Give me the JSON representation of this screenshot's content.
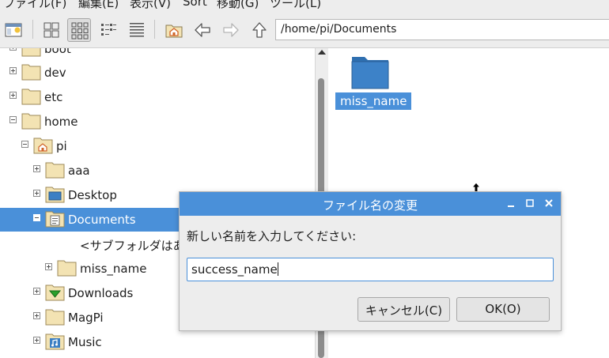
{
  "menu": [
    "ファイル(F)",
    "編集(E)",
    "表示(V)",
    "Sort",
    "移動(G)",
    "ツール(L)"
  ],
  "toolbar": {
    "path": "/home/pi/Documents",
    "buttons": [
      "new-window-icon",
      "icon-view-icon",
      "thumbnail-view-icon",
      "compact-view-icon",
      "detailed-list-view-icon",
      "home-icon",
      "back-icon",
      "forward-icon",
      "up-icon"
    ]
  },
  "tree": {
    "items": [
      {
        "label": "boot",
        "expander": "plus",
        "icon": "folder"
      },
      {
        "label": "dev",
        "expander": "plus",
        "icon": "folder"
      },
      {
        "label": "etc",
        "expander": "plus",
        "icon": "folder"
      },
      {
        "label": "home",
        "expander": "minus",
        "icon": "folder"
      },
      {
        "label": "pi",
        "expander": "minus",
        "icon": "home-folder"
      },
      {
        "label": "aaa",
        "expander": "plus",
        "icon": "folder"
      },
      {
        "label": "Desktop",
        "expander": "plus",
        "icon": "desktop-folder"
      },
      {
        "label": "Documents",
        "expander": "minus",
        "icon": "documents-folder",
        "selected": true
      },
      {
        "label": "<サブフォルダはあ",
        "expander": "none",
        "icon": "none"
      },
      {
        "label": "miss_name",
        "expander": "plus",
        "icon": "folder"
      },
      {
        "label": "Downloads",
        "expander": "plus",
        "icon": "downloads-folder"
      },
      {
        "label": "MagPi",
        "expander": "plus",
        "icon": "folder"
      },
      {
        "label": "Music",
        "expander": "plus",
        "icon": "music-folder"
      }
    ]
  },
  "main": {
    "files": [
      {
        "name": "miss_name",
        "icon": "folder-blue",
        "selected": true
      }
    ]
  },
  "dialog": {
    "title": "ファイル名の変更",
    "prompt": "新しい名前を入力してください:",
    "value": "success_name",
    "cancel_label": "キャンセル(C)",
    "ok_label": "OK(O)",
    "window_buttons": [
      "minimize-icon",
      "maximize-icon",
      "close-icon"
    ]
  },
  "colors": {
    "accent": "#4a90d9",
    "chrome": "#ededed",
    "folder_fill": "#f3e3b3",
    "folder_blue": "#3a7cc0"
  }
}
